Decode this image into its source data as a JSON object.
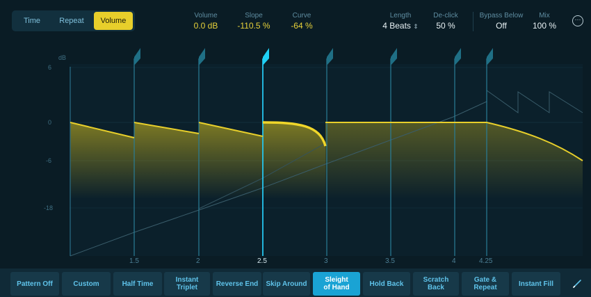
{
  "tabs": [
    {
      "label": "Time",
      "active": false
    },
    {
      "label": "Repeat",
      "active": false
    },
    {
      "label": "Volume",
      "active": true
    }
  ],
  "params": {
    "volume": {
      "label": "Volume",
      "value": "0.0 dB"
    },
    "slope": {
      "label": "Slope",
      "value": "-110.5 %"
    },
    "curve": {
      "label": "Curve",
      "value": "-64 %"
    },
    "length": {
      "label": "Length",
      "value": "4 Beats"
    },
    "declick": {
      "label": "De-click",
      "value": "50 %"
    },
    "bypass_below": {
      "label": "Bypass Below",
      "value": "Off"
    },
    "mix": {
      "label": "Mix",
      "value": "100 %"
    }
  },
  "more_button": "⋯",
  "graph": {
    "y_unit": "dB",
    "db_labels": [
      "6",
      "0",
      "-6",
      "-18"
    ],
    "beat_labels": [
      "1.5",
      "2",
      "2.5",
      "3",
      "3.5",
      "4",
      "4.25"
    ],
    "selected_marker": "2.5"
  },
  "presets": [
    {
      "label": "Pattern Off",
      "active": false
    },
    {
      "label": "Custom",
      "active": false
    },
    {
      "label": "Half Time",
      "active": false
    },
    {
      "label": "Instant\nTriplet",
      "active": false
    },
    {
      "label": "Reverse End",
      "active": false
    },
    {
      "label": "Skip Around",
      "active": false
    },
    {
      "label": "Sleight\nof Hand",
      "active": true
    },
    {
      "label": "Hold Back",
      "active": false
    },
    {
      "label": "Scratch\nBack",
      "active": false
    },
    {
      "label": "Gate &\nRepeat",
      "active": false
    },
    {
      "label": "Instant Fill",
      "active": false
    }
  ],
  "colors": {
    "accent_yellow": "#e8cf2b",
    "active_preset": "#1aa3d4",
    "marker_cyan": "#1fd0f5",
    "marker_dark": "#1f6f85"
  }
}
